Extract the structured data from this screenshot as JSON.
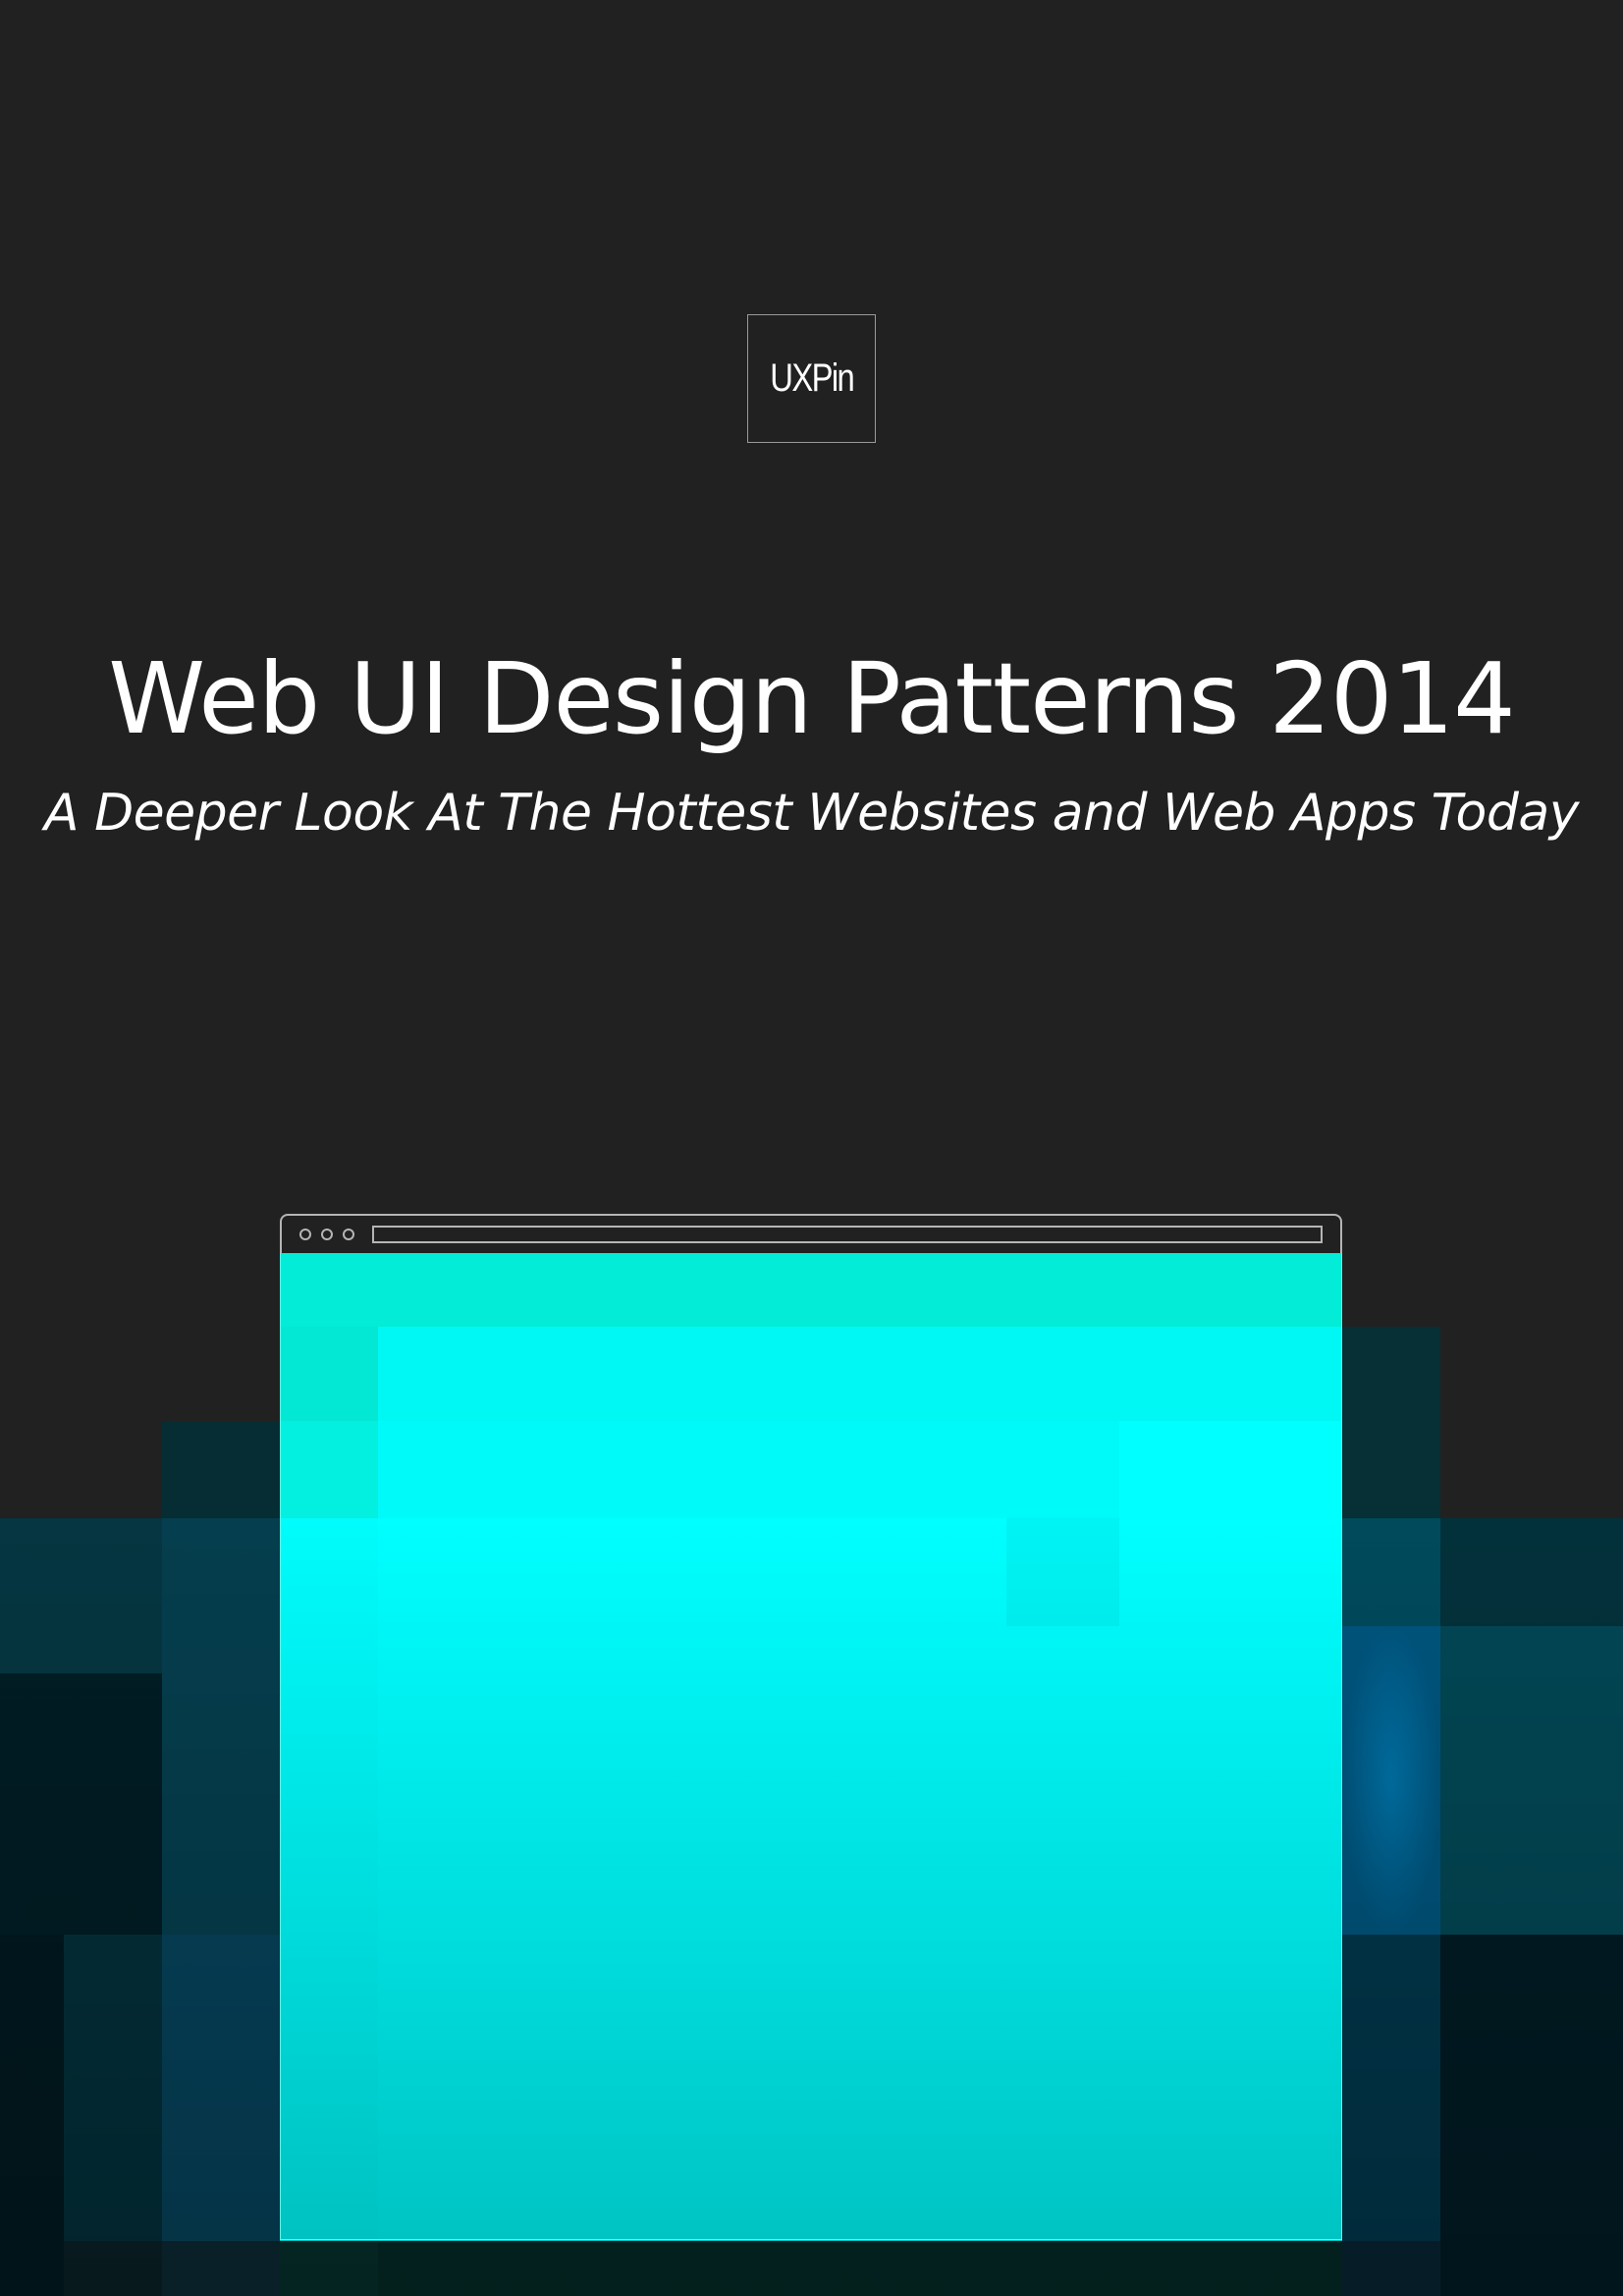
{
  "logo": {
    "text": "UXPin"
  },
  "cover": {
    "title": "Web UI Design Patterns 2014",
    "subtitle": "A Deeper Look At The Hottest Websites and Web Apps Today"
  },
  "colors": {
    "background": "#212121",
    "screen": "#00ffff",
    "screen_header": "#02ecd8",
    "accent_blue": "#006ea1",
    "text": "#ffffff"
  },
  "illustration": {
    "browser_icon": "browser-window-icon",
    "window_controls": [
      "window-dot-icon",
      "window-dot-icon",
      "window-dot-icon"
    ]
  }
}
